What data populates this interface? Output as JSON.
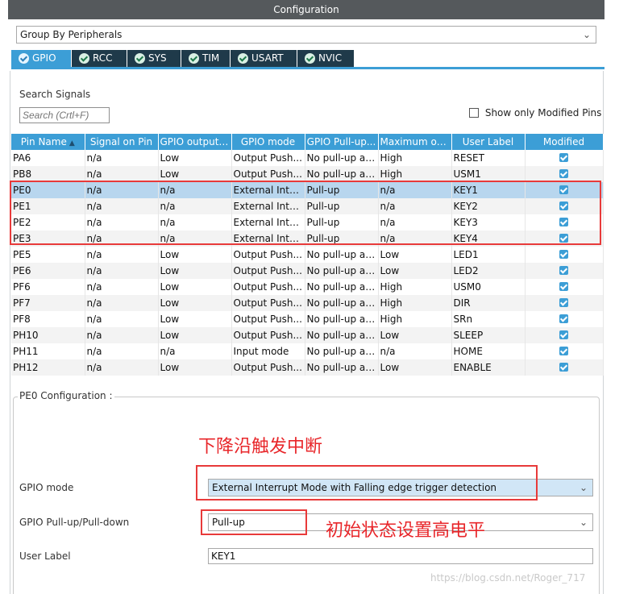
{
  "title": "Configuration",
  "group_select": {
    "value": "Group By Peripherals",
    "chevron_icon": "chevron-down-icon"
  },
  "tabs": [
    {
      "label": "GPIO",
      "active": true
    },
    {
      "label": "RCC",
      "active": false
    },
    {
      "label": "SYS",
      "active": false
    },
    {
      "label": "TIM",
      "active": false
    },
    {
      "label": "USART",
      "active": false
    },
    {
      "label": "NVIC",
      "active": false
    }
  ],
  "search": {
    "label": "Search Signals",
    "placeholder": "Search (Crtl+F)"
  },
  "show_modified": {
    "label": "Show only Modified Pins",
    "checked": false
  },
  "table": {
    "columns": [
      "Pin Name",
      "Signal on Pin",
      "GPIO output ...",
      "GPIO mode",
      "GPIO Pull-up...",
      "Maximum ou...",
      "User Label",
      "Modified"
    ],
    "rows": [
      [
        "PA6",
        "n/a",
        "Low",
        "Output Push...",
        "No pull-up an...",
        "High",
        "RESET"
      ],
      [
        "PB8",
        "n/a",
        "Low",
        "Output Push...",
        "No pull-up an...",
        "High",
        "USM1"
      ],
      [
        "PE0",
        "n/a",
        "n/a",
        "External Inte...",
        "Pull-up",
        "n/a",
        "KEY1"
      ],
      [
        "PE1",
        "n/a",
        "n/a",
        "External Inte...",
        "Pull-up",
        "n/a",
        "KEY2"
      ],
      [
        "PE2",
        "n/a",
        "n/a",
        "External Inte...",
        "Pull-up",
        "n/a",
        "KEY3"
      ],
      [
        "PE3",
        "n/a",
        "n/a",
        "External Inte...",
        "Pull-up",
        "n/a",
        "KEY4"
      ],
      [
        "PE5",
        "n/a",
        "Low",
        "Output Push...",
        "No pull-up an...",
        "Low",
        "LED1"
      ],
      [
        "PE6",
        "n/a",
        "Low",
        "Output Push...",
        "No pull-up an...",
        "Low",
        "LED2"
      ],
      [
        "PF6",
        "n/a",
        "Low",
        "Output Push...",
        "No pull-up an...",
        "High",
        "USM0"
      ],
      [
        "PF7",
        "n/a",
        "Low",
        "Output Push...",
        "No pull-up an...",
        "High",
        "DIR"
      ],
      [
        "PF8",
        "n/a",
        "Low",
        "Output Push...",
        "No pull-up an...",
        "High",
        "SRn"
      ],
      [
        "PH10",
        "n/a",
        "Low",
        "Output Push...",
        "No pull-up an...",
        "Low",
        "SLEEP"
      ],
      [
        "PH11",
        "n/a",
        "n/a",
        "Input mode",
        "No pull-up an...",
        "n/a",
        "HOME"
      ],
      [
        "PH12",
        "n/a",
        "Low",
        "Output Push...",
        "No pull-up an...",
        "Low",
        "ENABLE"
      ]
    ],
    "selected_row": 2
  },
  "pin_config": {
    "legend": "PE0 Configuration :",
    "annotation_top": "下降沿触发中断",
    "annotation_pull": "初始状态设置高电平",
    "gpio_mode_label": "GPIO mode",
    "gpio_mode_value": "External Interrupt Mode with Falling edge trigger detection",
    "pull_label": "GPIO Pull-up/Pull-down",
    "pull_value": "Pull-up",
    "user_label_label": "User Label",
    "user_label_value": "KEY1"
  },
  "watermark": "https://blog.csdn.net/Roger_717",
  "colors": {
    "accent": "#3c9ed6",
    "tab_dark": "#1f3a4a",
    "title_bar": "#55595c",
    "annotation_red": "#e8262a",
    "selected_row": "#b8d6ee"
  }
}
